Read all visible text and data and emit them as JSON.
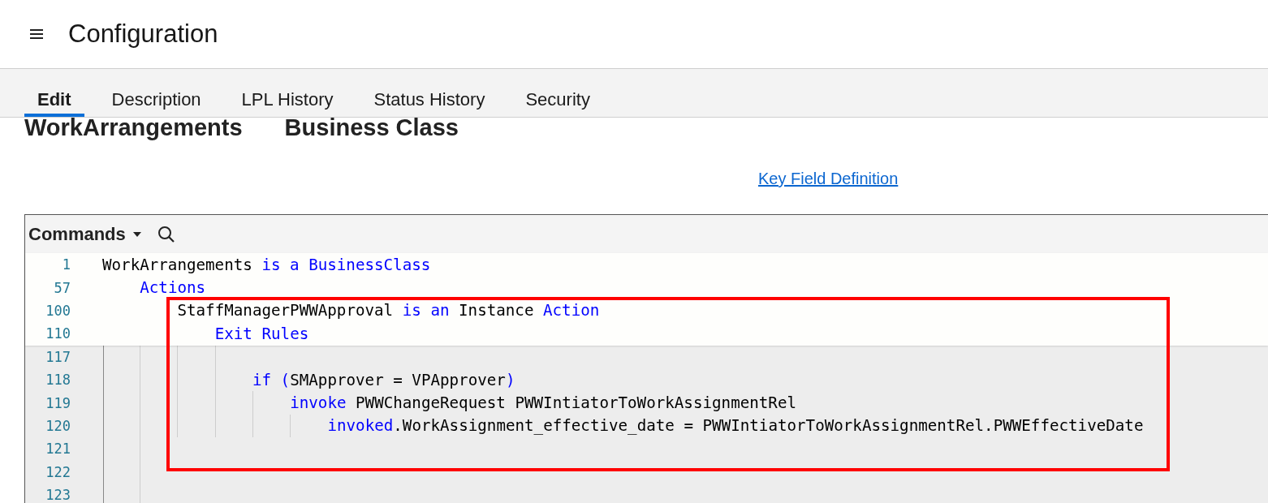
{
  "header": {
    "title": "Configuration"
  },
  "tabs": [
    {
      "label": "Edit",
      "selected": true
    },
    {
      "label": "Description",
      "selected": false
    },
    {
      "label": "LPL History",
      "selected": false
    },
    {
      "label": "Status History",
      "selected": false
    },
    {
      "label": "Security",
      "selected": false
    }
  ],
  "heading": {
    "name": "WorkArrangements",
    "type": "Business Class"
  },
  "link": "Key Field Definition",
  "editor": {
    "toolbar": {
      "commands": "Commands"
    },
    "highlight": {
      "kind": "box"
    },
    "lines": [
      {
        "number": "1",
        "pinned": true,
        "tokens": [
          {
            "text": "WorkArrangements",
            "keyword": false
          },
          {
            "text": " is a BusinessClass",
            "keyword": true
          }
        ],
        "children": [
          {
            "number": "57",
            "pinned": true,
            "tokens": [
              {
                "text": "Actions",
                "keyword": true
              }
            ],
            "children": [
              {
                "number": "100",
                "pinned": true,
                "tokens": [
                  {
                    "text": "StaffManagerPWWApproval",
                    "keyword": false
                  },
                  {
                    "text": " is an ",
                    "keyword": true
                  },
                  {
                    "text": "Instance",
                    "keyword": false
                  },
                  {
                    "text": " Action",
                    "keyword": true
                  }
                ],
                "children": [
                  {
                    "number": "110",
                    "pinned": true,
                    "tokens": [
                      {
                        "text": "Exit Rules",
                        "keyword": true
                      }
                    ],
                    "children": [
                      {
                        "number": "117",
                        "pinned": false
                      },
                      {
                        "number": "118",
                        "pinned": false,
                        "tokens": [
                          {
                            "text": "if (",
                            "keyword": true
                          },
                          {
                            "text": "SMApprover = VPApprover",
                            "keyword": false
                          },
                          {
                            "text": ")",
                            "keyword": true
                          }
                        ],
                        "children": [
                          {
                            "number": "119",
                            "pinned": false,
                            "tokens": [
                              {
                                "text": "invoke",
                                "keyword": true
                              },
                              {
                                "text": " PWWChangeRequest PWWIntiatorToWorkAssignmentRel",
                                "keyword": false
                              }
                            ],
                            "children": [
                              {
                                "number": "120",
                                "pinned": false,
                                "tokens": [
                                  {
                                    "text": "invoked",
                                    "keyword": true
                                  },
                                  {
                                    "text": ".WorkAssignment_effective_date = PWWIntiatorToWorkAssignmentRel.PWWEffectiveDate",
                                    "keyword": false
                                  }
                                ]
                              }
                            ]
                          }
                        ]
                      }
                    ]
                  }
                ]
              },
              {
                "number": "121",
                "pinned": false
              },
              {
                "number": "122",
                "pinned": false
              },
              {
                "number": "123",
                "pinned": false
              }
            ]
          }
        ]
      }
    ]
  }
}
